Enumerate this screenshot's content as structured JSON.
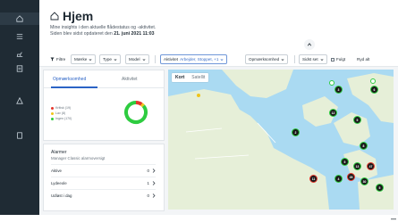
{
  "header": {
    "title": "Hjem",
    "subtitle_line1": "Mine insights i den aktuelle flådestatus og -aktivitet.",
    "subtitle_line2_prefix": "Siden blev sidst opdateret den ",
    "subtitle_line2_date": "21. juni 2021 11:03"
  },
  "filters": {
    "filter_label": "Filtre",
    "brand_label": "Mærke",
    "type_label": "Type",
    "model_label": "Model",
    "activity_label": "Aktivitet",
    "activity_value": "Arbejder, Stoppet, +1",
    "workshop_label": "Opmærksomhed",
    "last_seen_label": "Sidst set",
    "followed_label": "Fulgt",
    "clear_label": "Ryd alt"
  },
  "status_card": {
    "tabs": [
      "Opmærksomhed",
      "Aktivitet"
    ],
    "legend": [
      {
        "label": "Kritisk (19)",
        "color": "#e5362b"
      },
      {
        "label": "Lav (8)",
        "color": "#f0c419"
      },
      {
        "label": "Ingen (170)",
        "color": "#2ecc40"
      }
    ],
    "donut": {
      "critical": 19,
      "low": 8,
      "none": 170
    }
  },
  "alarms_card": {
    "title": "Alarmer",
    "subtitle": "Manager Classic alarmoversigt",
    "rows": [
      {
        "label": "Aktive",
        "count": "0"
      },
      {
        "label": "Lydeeole",
        "count": "1"
      },
      {
        "label": "Udløst i dag",
        "count": "0"
      }
    ]
  },
  "map": {
    "tabs": [
      "Kort",
      "Satellit"
    ],
    "markers": [
      {
        "label": "6",
        "status": "green"
      },
      {
        "label": "3",
        "status": "green"
      },
      {
        "label": "12",
        "status": "green"
      },
      {
        "label": "5",
        "status": "green"
      },
      {
        "label": "2",
        "status": "green"
      },
      {
        "label": "8",
        "status": "green"
      },
      {
        "label": "5",
        "status": "green"
      },
      {
        "label": "13",
        "status": "green"
      },
      {
        "label": "47",
        "status": "red"
      },
      {
        "label": "11",
        "status": "red"
      },
      {
        "label": "4",
        "status": "green"
      },
      {
        "label": "28",
        "status": "red"
      },
      {
        "label": "30",
        "status": "green"
      },
      {
        "label": "5",
        "status": "green"
      }
    ]
  },
  "colors": {
    "sidebar": "#1f2b34",
    "accent": "#2b63c6",
    "critical": "#e5362b",
    "low": "#f0c419",
    "ok": "#2ecc40"
  }
}
